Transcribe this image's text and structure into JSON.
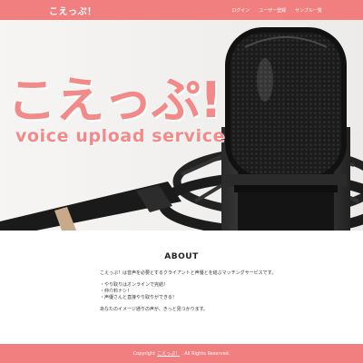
{
  "navbar": {
    "brand": "こえっぷ！",
    "links": [
      {
        "label": "ログイン"
      },
      {
        "label": "ユーザー登録"
      },
      {
        "label": "サンプル一覧"
      }
    ]
  },
  "hero": {
    "title": "こえっぷ!",
    "subtitle": "voice upload service"
  },
  "about": {
    "title": "ABOUT",
    "lines": [
      "こえっぷ！は音声を必要とするクライアントと声優とを結ぶマッチングサービスです。",
      "・やり取りはオンラインで完結！",
      "・仲介料ナシ！",
      "・声優さんと直接やり取りができる！",
      "あなたのイメージ通りの声が、きっと見つかります。"
    ]
  },
  "footer": {
    "copyright_prefix": "Copyright",
    "link": "こえっぷ！",
    "suffix": ". All Rights Reserved."
  },
  "colors": {
    "accent": "#f27f7f",
    "hero_text": "#f28a8a"
  }
}
